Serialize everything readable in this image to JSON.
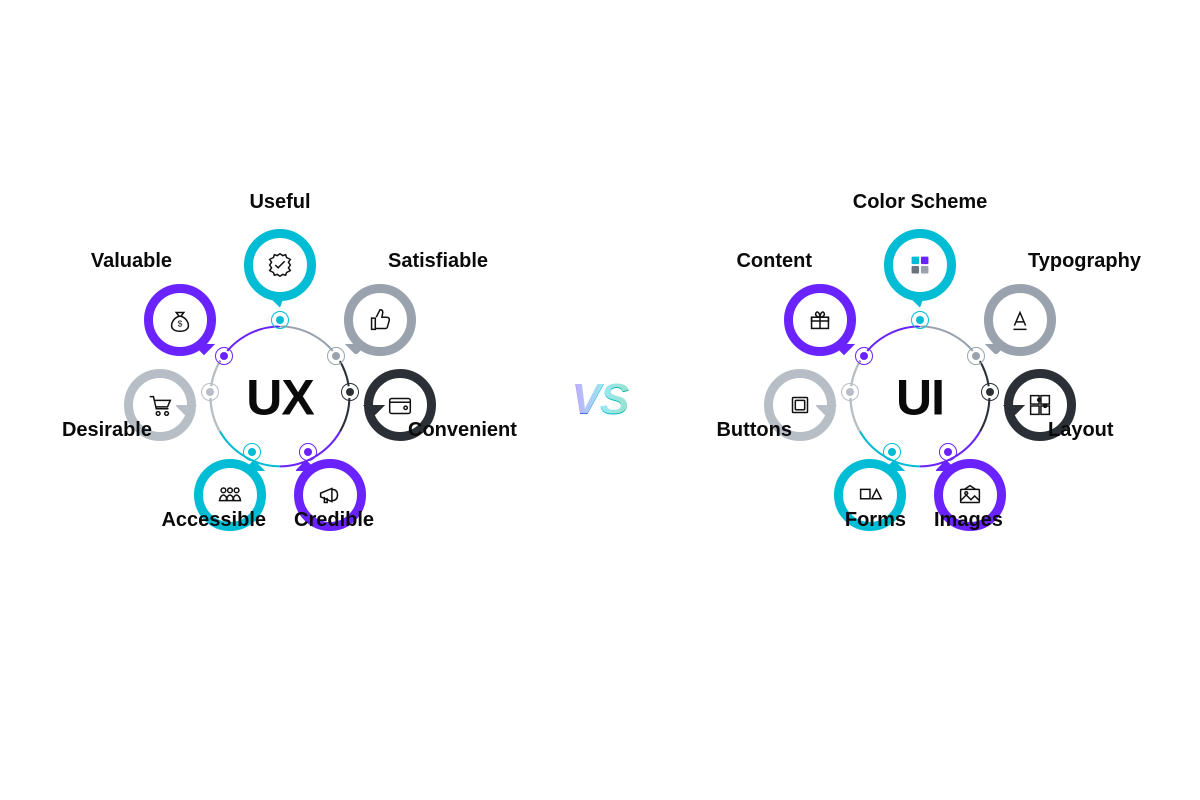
{
  "diagram": {
    "vs_label": "VS",
    "left": {
      "title": "UX",
      "items": [
        {
          "id": "useful",
          "label": "Useful",
          "icon": "badge-check",
          "color": "cyan"
        },
        {
          "id": "satisfiable",
          "label": "Satisfiable",
          "icon": "thumbs-up",
          "color": "gray"
        },
        {
          "id": "convenient",
          "label": "Convenient",
          "icon": "wallet",
          "color": "dark"
        },
        {
          "id": "credible",
          "label": "Credible",
          "icon": "megaphone",
          "color": "purple"
        },
        {
          "id": "accessible",
          "label": "Accessible",
          "icon": "people",
          "color": "cyan"
        },
        {
          "id": "desirable",
          "label": "Desirable",
          "icon": "cart",
          "color": "lgray"
        },
        {
          "id": "valuable",
          "label": "Valuable",
          "icon": "money-bag",
          "color": "purple"
        }
      ]
    },
    "right": {
      "title": "UI",
      "items": [
        {
          "id": "color-scheme",
          "label": "Color Scheme",
          "icon": "swatches",
          "color": "cyan"
        },
        {
          "id": "typography",
          "label": "Typography",
          "icon": "type",
          "color": "gray"
        },
        {
          "id": "layout",
          "label": "Layout",
          "icon": "puzzle",
          "color": "dark"
        },
        {
          "id": "images",
          "label": "Images",
          "icon": "image",
          "color": "purple"
        },
        {
          "id": "forms",
          "label": "Forms",
          "icon": "shapes",
          "color": "cyan"
        },
        {
          "id": "buttons",
          "label": "Buttons",
          "icon": "square",
          "color": "lgray"
        },
        {
          "id": "content",
          "label": "Content",
          "icon": "gift",
          "color": "purple"
        }
      ]
    }
  },
  "colors": {
    "cyan": "#00bcd4",
    "gray": "#9aa3ad",
    "dark": "#2b2f36",
    "purple": "#6a23ff",
    "lgray": "#b7bec6"
  }
}
